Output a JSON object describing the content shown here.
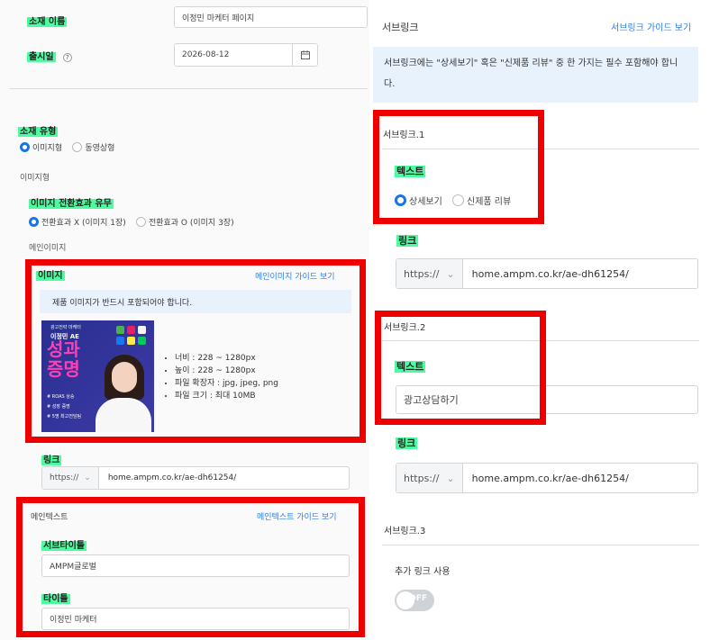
{
  "left": {
    "asset_name_label": "소재 이름",
    "asset_name_value": "이정민 마케터 페이지",
    "launch_date_label": "출시일",
    "launch_date_value": "2026-08-12",
    "asset_type_label": "소재 유형",
    "asset_type_options": [
      "이미지형",
      "동영상형"
    ],
    "image_type_heading": "이미지형",
    "transition_label": "이미지 전환효과 유무",
    "transition_options": [
      "전환효과 X (이미지 1장)",
      "전환효과 O (이미지 3장)"
    ],
    "main_image_heading": "메인이미지",
    "image_label": "이미지",
    "image_guide_link": "메인이미지 가이드 보기",
    "image_notice": "제품 이미지가 반드시 포함되어야 합니다.",
    "image_specs": [
      "너비 : 228 ~ 1280px",
      "높이 : 228 ~ 1280px",
      "파일 확장자 : jpg, jpeg, png",
      "파일 크기 : 최대 10MB"
    ],
    "thumb": {
      "top_tag": "광고전략 마케터",
      "name": "이정민 AE",
      "headline_1": "성과",
      "headline_2": "증명",
      "items": [
        "# ROAS 상승",
        "# 성장 증명",
        "# 5명 최고전담팀"
      ]
    },
    "link_label": "링크",
    "link_prefix": "https://",
    "link_value": "home.ampm.co.kr/ae-dh61254/",
    "main_text_heading": "메인텍스트",
    "main_text_guide_link": "메인텍스트 가이드 보기",
    "subtitle_label": "서브타이틀",
    "subtitle_value": "AMPM글로벌",
    "title_label": "타이틀",
    "title_value": "이정민 마케터"
  },
  "right": {
    "sublink_heading": "서브링크",
    "sublink_guide_link": "서브링크 가이드 보기",
    "sublink_notice": "서브링크에는 \"상세보기\" 혹은 \"신제품 리뷰\" 중 한 가지는 필수 포함해야 합니다.",
    "sublink1_title": "서브링크.1",
    "text_label": "텍스트",
    "sublink1_options": [
      "상세보기",
      "신제품 리뷰"
    ],
    "link_label": "링크",
    "link_prefix": "https://",
    "link_value": "home.ampm.co.kr/ae-dh61254/",
    "sublink2_title": "서브링크.2",
    "sublink2_text_value": "광고상담하기",
    "sublink3_title": "서브링크.3",
    "extra_link_label": "추가 링크 사용",
    "toggle_state": "OFF"
  },
  "colors": {
    "highlight": "#4dfca0",
    "red_frame": "#ee0000",
    "accent": "#1a73e8"
  }
}
